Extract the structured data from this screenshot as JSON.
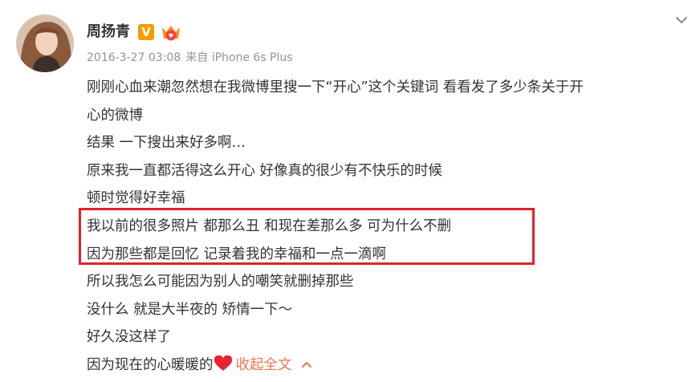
{
  "post": {
    "author": "周扬青",
    "timestamp": "2016-3-27 03:08",
    "source": "来自 iPhone 6s Plus",
    "lines": [
      "刚刚心血来潮忽然想在我微博里搜一下“开心”这个关键词 看看发了多少条关于开",
      "心的微博",
      "结果 一下搜出来好多啊…",
      "原来我一直都活得这么开心 好像真的很少有不快乐的时候",
      "顿时觉得好幸福",
      "我以前的很多照片 都那么丑 和现在差那么多 可为什么不删",
      "因为那些都是回忆 记录着我的幸福和一点一滴啊",
      "所以我怎么可能因为别人的嘲笑就删掉那些",
      "没什么 就是大半夜的 矫情一下～",
      "好久没这样了"
    ],
    "last_line_text": "因为现在的心暖暖的",
    "collapse_label": "收起全文",
    "verified_badge": "V",
    "icons": [
      "heart-icon",
      "chevron-down-icon",
      "chevron-up-icon",
      "vip-crown-icon"
    ],
    "colors": {
      "link": "#eb7350",
      "highlight_box": "#e1212b",
      "meta": "#939393",
      "verified": "#f59b00",
      "heart": "#e8232f"
    }
  }
}
